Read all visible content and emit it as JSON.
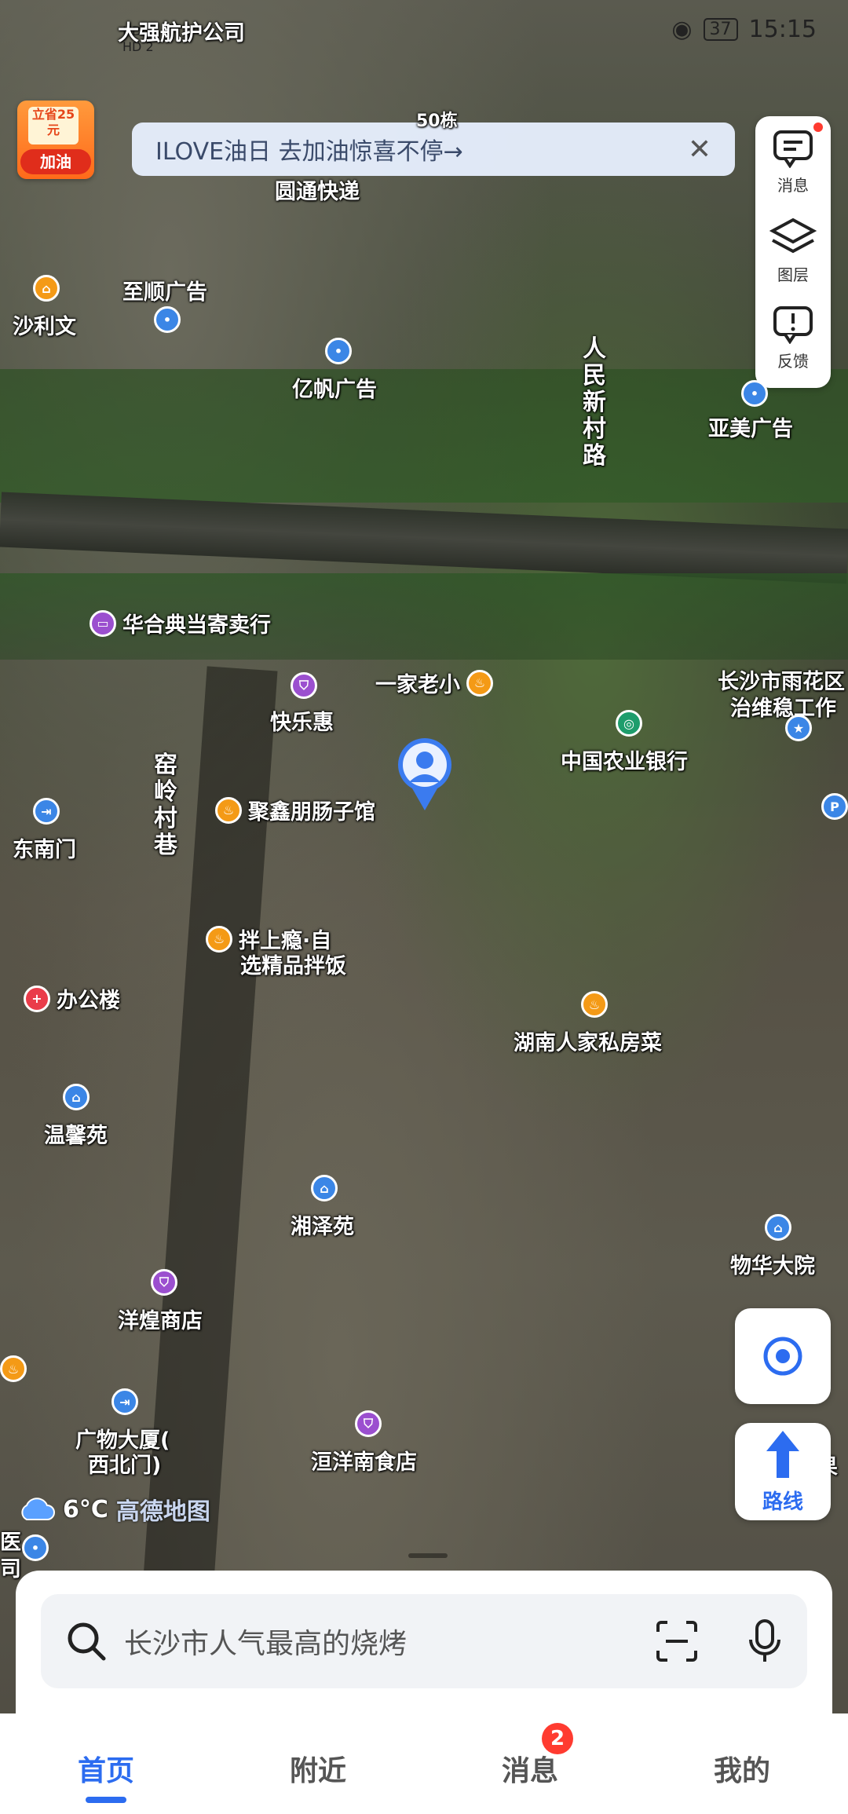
{
  "status_bar": {
    "time": "15:15",
    "battery": "37",
    "hd1": "HD",
    "hd2": "HD 2"
  },
  "promo": {
    "badge_top": "立省25元",
    "badge_bottom": "加油",
    "banner_text": "ILOVE油日 去加油惊喜不停→",
    "close": "✕"
  },
  "toolbar": {
    "messages": "消息",
    "layers": "图层",
    "feedback": "反馈"
  },
  "pois": [
    {
      "label": "大强航护公司",
      "color": "blue",
      "glyph": ""
    },
    {
      "label": "50栋",
      "color": "",
      "glyph": ""
    },
    {
      "label": "圆通快递",
      "color": "",
      "glyph": ""
    },
    {
      "label": "沙利文",
      "color": "orange",
      "glyph": "⌂"
    },
    {
      "label": "至顺广告",
      "color": "blue",
      "glyph": "•"
    },
    {
      "label": "亿帆广告",
      "color": "blue",
      "glyph": "•"
    },
    {
      "label": "亚美广告",
      "color": "blue",
      "glyph": "•"
    },
    {
      "label": "华合典当寄卖行",
      "color": "purple",
      "glyph": "▭"
    },
    {
      "label": "一家老小",
      "color": "orange",
      "glyph": "♨"
    },
    {
      "label": "长沙市雨花区",
      "color": "",
      "glyph": ""
    },
    {
      "label": "治维稳工作",
      "color": "blue",
      "glyph": "★"
    },
    {
      "label": "快乐惠",
      "color": "purple",
      "glyph": "⛉"
    },
    {
      "label": "中国农业银行",
      "color": "green",
      "glyph": "◎"
    },
    {
      "label": "东南门",
      "color": "blue",
      "glyph": "⇥"
    },
    {
      "label": "聚鑫朋肠子馆",
      "color": "orange",
      "glyph": "♨"
    },
    {
      "label": "拌上瘾·自",
      "color": "orange",
      "glyph": "♨"
    },
    {
      "label": "选精品拌饭",
      "color": "",
      "glyph": ""
    },
    {
      "label": "办公楼",
      "color": "red",
      "glyph": "+"
    },
    {
      "label": "湖南人家私房菜",
      "color": "orange",
      "glyph": "♨"
    },
    {
      "label": "温馨苑",
      "color": "blue",
      "glyph": "⌂"
    },
    {
      "label": "湘泽苑",
      "color": "blue",
      "glyph": "⌂"
    },
    {
      "label": "物华大院",
      "color": "blue",
      "glyph": "⌂"
    },
    {
      "label": "洋煌商店",
      "color": "purple",
      "glyph": "⛉"
    },
    {
      "label": "广物大厦(",
      "color": "blue",
      "glyph": "⇥"
    },
    {
      "label": "西北门)",
      "color": "",
      "glyph": ""
    },
    {
      "label": "洹洋南食店",
      "color": "purple",
      "glyph": "⛉"
    },
    {
      "label": "医",
      "color": "blue",
      "glyph": "•"
    },
    {
      "label": "司",
      "color": "",
      "glyph": ""
    },
    {
      "label": "果",
      "color": "purple",
      "glyph": ""
    }
  ],
  "roads": {
    "road1": "人民新村路",
    "road2": "窑岭村巷"
  },
  "parking": "P",
  "weather": {
    "temp": "6°C",
    "brand": "高德地图"
  },
  "route_label": "路线",
  "search": {
    "placeholder": "长沙市人气最高的烧烤"
  },
  "nav": {
    "home": "首页",
    "nearby": "附近",
    "messages": "消息",
    "mine": "我的",
    "messages_badge": "2"
  }
}
